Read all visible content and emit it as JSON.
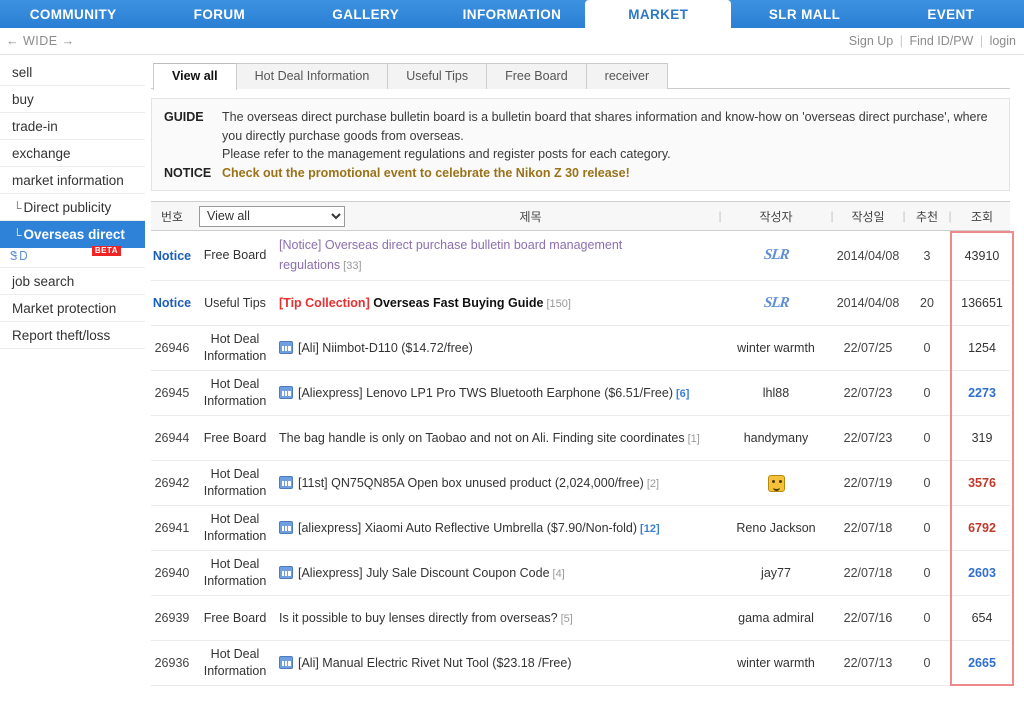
{
  "topnav": {
    "items": [
      {
        "label": "COMMUNITY",
        "active": false
      },
      {
        "label": "FORUM",
        "active": false
      },
      {
        "label": "GALLERY",
        "active": false
      },
      {
        "label": "INFORMATION",
        "active": false
      },
      {
        "label": "MARKET",
        "active": true
      },
      {
        "label": "SLR MALL",
        "active": false
      },
      {
        "label": "EVENT",
        "active": false
      }
    ],
    "accent_color": "#2a7fd4",
    "active_text_color": "#2e78c8"
  },
  "utilbar": {
    "wide_toggle": "← WIDE →",
    "auth": {
      "signup": "Sign Up",
      "find": "Find ID/PW",
      "login": "login",
      "separator": "|"
    }
  },
  "sidebar": {
    "items": [
      {
        "label": "sell",
        "sub": false,
        "active": false
      },
      {
        "label": "buy",
        "sub": false,
        "active": false
      },
      {
        "label": "trade-in",
        "sub": false,
        "active": false
      },
      {
        "label": "exchange",
        "sub": false,
        "active": false
      },
      {
        "label": "market information",
        "sub": false,
        "active": false
      },
      {
        "label": "Direct publicity",
        "sub": true,
        "active": false,
        "lead": "└"
      },
      {
        "label": "Overseas direct",
        "sub": true,
        "active": true,
        "lead": "└"
      }
    ],
    "beta_badge": "BETA",
    "beta_glyph": "ᏕᎠ",
    "after_items": [
      {
        "label": "job search",
        "sub": false,
        "active": false
      },
      {
        "label": "Market protection",
        "sub": false,
        "active": false
      },
      {
        "label": "Report theft/loss",
        "sub": false,
        "active": false
      }
    ]
  },
  "tabs": [
    {
      "label": "View all",
      "active": true
    },
    {
      "label": "Hot Deal Information",
      "active": false
    },
    {
      "label": "Useful Tips",
      "active": false
    },
    {
      "label": "Free Board",
      "active": false
    },
    {
      "label": "receiver",
      "active": false
    }
  ],
  "guide": {
    "guide_label": "GUIDE",
    "guide_lines": [
      "The overseas direct purchase bulletin board is a bulletin board that shares information and know-how on 'overseas direct purchase', where you directly purchase goods from overseas.",
      "Please refer to the management regulations and register posts for each category."
    ],
    "notice_label": "NOTICE",
    "notice_text": "Check out the promotional event to celebrate the Nikon Z 30 release!"
  },
  "table": {
    "headers": {
      "no": "번호",
      "category_filter_value": "View all",
      "category_filter_options": [
        "View all",
        "Hot Deal Information",
        "Useful Tips",
        "Free Board",
        "receiver"
      ],
      "title": "제목",
      "author": "작성자",
      "date": "작성일",
      "recommend": "추천",
      "views": "조회"
    },
    "highlight_color": "#f08a8a",
    "rows": [
      {
        "no": "Notice",
        "is_notice": true,
        "category": "Free Board",
        "has_image_icon": false,
        "title_prefix": "",
        "title": "[Notice] Overseas direct purchase bulletin board management regulations",
        "title_style": "link",
        "comments": "[33]",
        "comments_style": "gray",
        "author": "SLR",
        "author_type": "slr-logo",
        "date": "2014/04/08",
        "recommend": "3",
        "views": "43910",
        "views_style": "black"
      },
      {
        "no": "Notice",
        "is_notice": true,
        "category": "Useful Tips",
        "has_image_icon": false,
        "title_prefix": "[Tip Collection]",
        "title": "Overseas Fast Buying Guide",
        "title_style": "tip",
        "comments": "[150]",
        "comments_style": "gray",
        "author": "SLR",
        "author_type": "slr-logo",
        "date": "2014/04/08",
        "recommend": "20",
        "views": "136651",
        "views_style": "black"
      },
      {
        "no": "26946",
        "is_notice": false,
        "category": "Hot Deal Information",
        "has_image_icon": true,
        "title_prefix": "",
        "title": "[Ali] Niimbot-D110 ($14.72/free)",
        "title_style": "plain",
        "comments": "",
        "comments_style": "gray",
        "author": "winter warmth",
        "author_type": "text",
        "date": "22/07/25",
        "recommend": "0",
        "views": "1254",
        "views_style": "black"
      },
      {
        "no": "26945",
        "is_notice": false,
        "category": "Hot Deal Information",
        "has_image_icon": true,
        "title_prefix": "",
        "title": "[Aliexpress] Lenovo LP1 Pro TWS Bluetooth Earphone ($6.51/Free)",
        "title_style": "plain",
        "comments": "[6]",
        "comments_style": "blue",
        "author": "lhl88",
        "author_type": "text",
        "date": "22/07/23",
        "recommend": "0",
        "views": "2273",
        "views_style": "blue"
      },
      {
        "no": "26944",
        "is_notice": false,
        "category": "Free Board",
        "has_image_icon": false,
        "title_prefix": "",
        "title": "The bag handle is only on Taobao and not on Ali. Finding site coordinates",
        "title_style": "plain",
        "comments": "[1]",
        "comments_style": "gray",
        "author": "handymany",
        "author_type": "text",
        "date": "22/07/23",
        "recommend": "0",
        "views": "319",
        "views_style": "black"
      },
      {
        "no": "26942",
        "is_notice": false,
        "category": "Hot Deal Information",
        "has_image_icon": true,
        "title_prefix": "",
        "title": "[11st] QN75QN85A Open box unused product (2,024,000/free)",
        "title_style": "plain",
        "comments": "[2]",
        "comments_style": "gray",
        "author": "",
        "author_type": "avatar",
        "date": "22/07/19",
        "recommend": "0",
        "views": "3576",
        "views_style": "red"
      },
      {
        "no": "26941",
        "is_notice": false,
        "category": "Hot Deal Information",
        "has_image_icon": true,
        "title_prefix": "",
        "title": "[aliexpress] Xiaomi Auto Reflective Umbrella ($7.90/Non-fold)",
        "title_style": "plain",
        "comments": "[12]",
        "comments_style": "blue",
        "author": "Reno Jackson",
        "author_type": "text",
        "date": "22/07/18",
        "recommend": "0",
        "views": "6792",
        "views_style": "red"
      },
      {
        "no": "26940",
        "is_notice": false,
        "category": "Hot Deal Information",
        "has_image_icon": true,
        "title_prefix": "",
        "title": "[Aliexpress] July Sale Discount Coupon Code",
        "title_style": "plain",
        "comments": "[4]",
        "comments_style": "gray",
        "author": "jay77",
        "author_type": "text",
        "date": "22/07/18",
        "recommend": "0",
        "views": "2603",
        "views_style": "blue"
      },
      {
        "no": "26939",
        "is_notice": false,
        "category": "Free Board",
        "has_image_icon": false,
        "title_prefix": "",
        "title": "Is it possible to buy lenses directly from overseas?",
        "title_style": "plain",
        "comments": "[5]",
        "comments_style": "gray",
        "author": "gama admiral",
        "author_type": "text",
        "date": "22/07/16",
        "recommend": "0",
        "views": "654",
        "views_style": "black"
      },
      {
        "no": "26936",
        "is_notice": false,
        "category": "Hot Deal Information",
        "has_image_icon": true,
        "title_prefix": "",
        "title": "[Ali] Manual Electric Rivet Nut Tool ($23.18 /Free)",
        "title_style": "plain",
        "comments": "",
        "comments_style": "gray",
        "author": "winter warmth",
        "author_type": "text",
        "date": "22/07/13",
        "recommend": "0",
        "views": "2665",
        "views_style": "blue"
      }
    ]
  }
}
